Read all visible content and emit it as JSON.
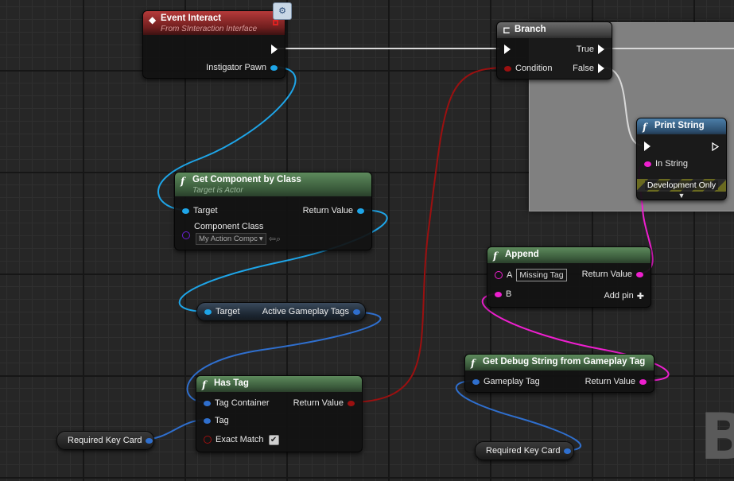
{
  "colors": {
    "exec_wire": "#ffffff",
    "object_pin": "#1ea5e8",
    "struct_pin": "#2f6fce",
    "bool_pin": "#9b1010",
    "string_pin": "#ee1fcf",
    "class_pin": "#6a1fd6"
  },
  "nodes": {
    "event_interact": {
      "icon": "event-diamond-icon",
      "title": "Event Interact",
      "subtitle": "From SInteraction Interface",
      "pin_instigator": "Instigator Pawn"
    },
    "branch": {
      "icon": "branch-icon",
      "title": "Branch",
      "pin_condition": "Condition",
      "pin_true": "True",
      "pin_false": "False"
    },
    "print_string": {
      "icon": "function-icon",
      "icon_glyph": "f",
      "title": "Print String",
      "pin_in_string": "In String",
      "banner": "Development Only",
      "expand_glyph": "▼"
    },
    "get_component": {
      "icon_glyph": "f",
      "title": "Get Component by Class",
      "subtitle": "Target is Actor",
      "pin_target": "Target",
      "pin_return": "Return Value",
      "pin_component_class": "Component Class",
      "component_class_value": "My Action Compc",
      "combo_arrow": "▾",
      "browse_glyphs": "⇦⌕"
    },
    "active_tags": {
      "pin_target": "Target",
      "pin_output": "Active Gameplay Tags"
    },
    "append": {
      "icon_glyph": "f",
      "title": "Append",
      "pin_a": "A",
      "pin_a_value": "Missing Tag",
      "pin_b": "B",
      "pin_return": "Return Value",
      "add_pin": "Add pin",
      "add_pin_glyph": "✚"
    },
    "has_tag": {
      "icon_glyph": "f",
      "title": "Has Tag",
      "pin_container": "Tag Container",
      "pin_tag": "Tag",
      "pin_exact": "Exact Match",
      "pin_return": "Return Value",
      "check_glyph": "✔"
    },
    "debug_string": {
      "icon_glyph": "f",
      "title": "Get Debug String from Gameplay Tag",
      "pin_tag": "Gameplay Tag",
      "pin_return": "Return Value"
    },
    "required_card_1": {
      "label": "Required Key Card"
    },
    "required_card_2": {
      "label": "Required Key Card"
    }
  },
  "comment": {
    "letter": "B"
  }
}
